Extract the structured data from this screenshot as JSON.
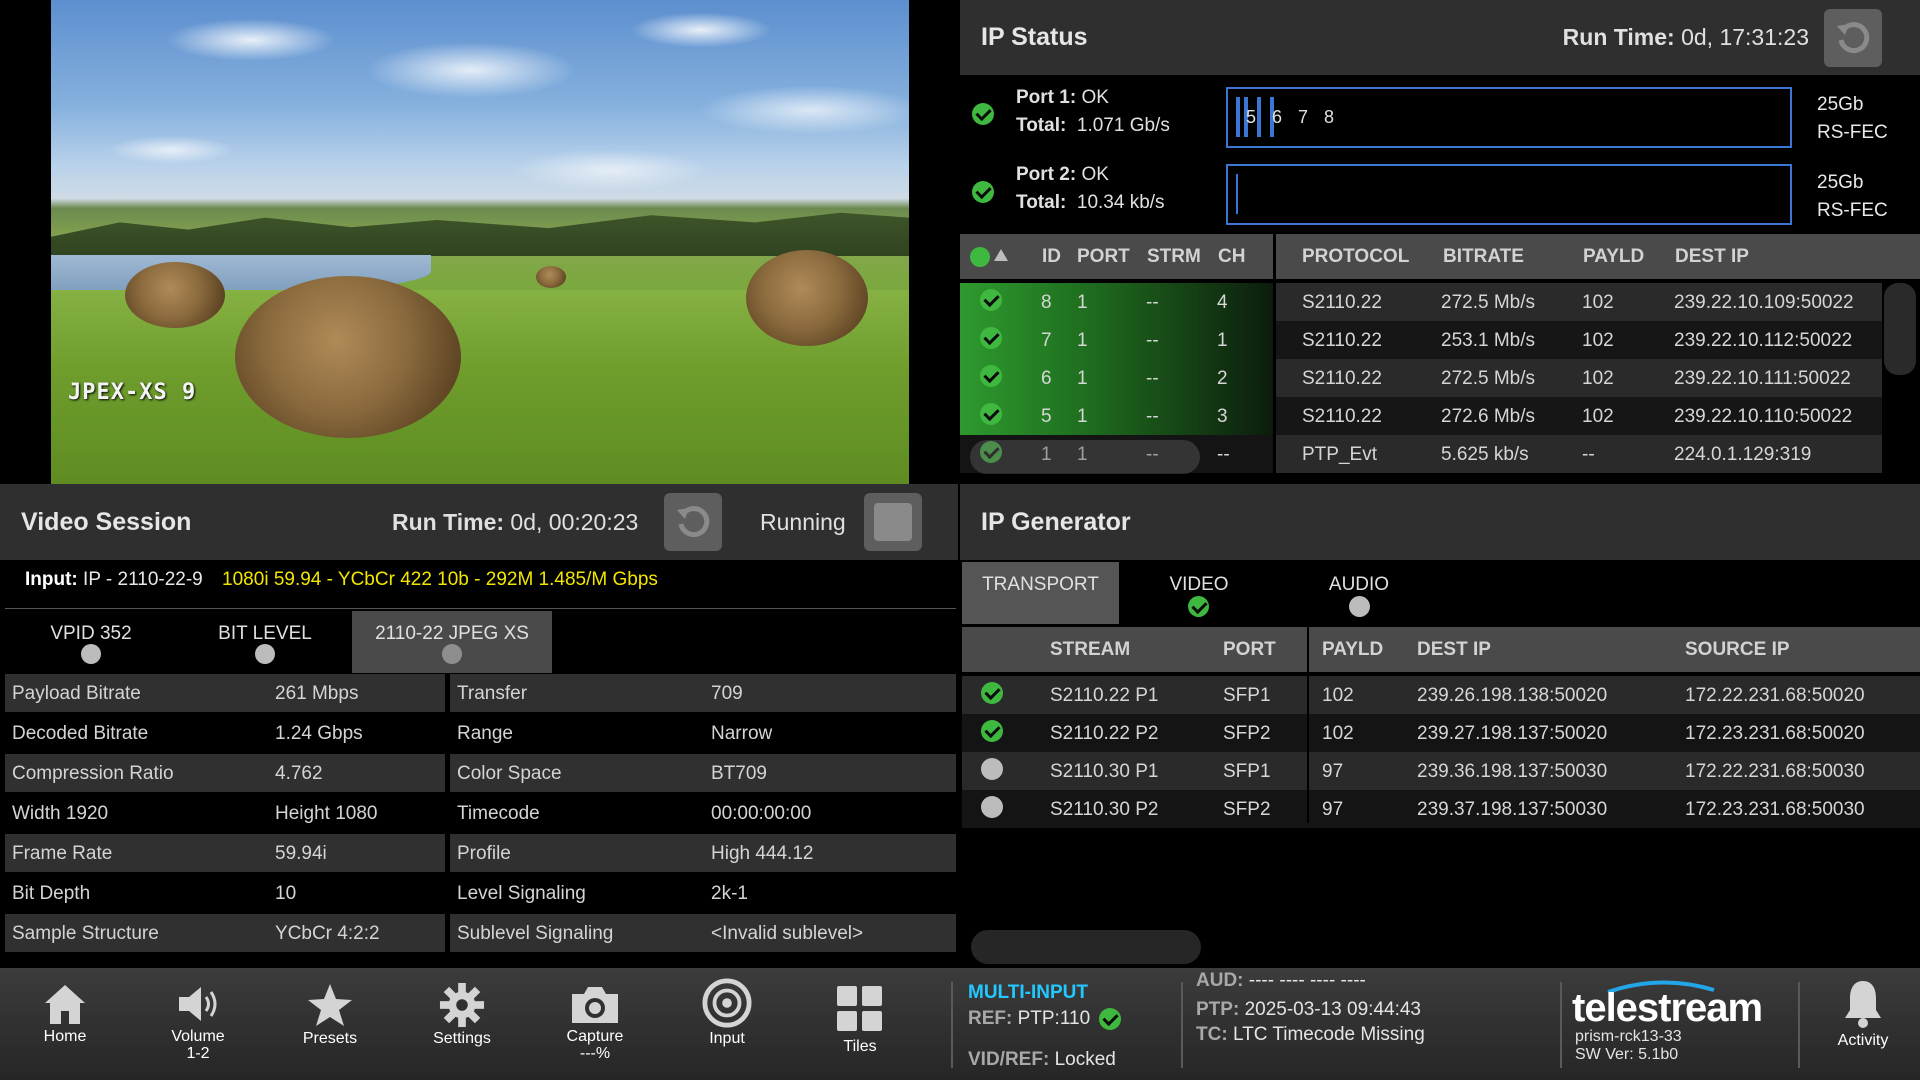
{
  "preview": {
    "overlay_label": "JPEX-XS 9"
  },
  "ip_status": {
    "title": "IP Status",
    "run_time_label": "Run Time:",
    "run_time_value": "0d, 17:31:23",
    "ports": [
      {
        "port_label": "Port 1:",
        "status": "OK",
        "total_label": "Total:",
        "total_value": "1.071 Gb/s",
        "bar_labels": [
          "5",
          "6",
          "7",
          "8"
        ],
        "speed": "25Gb",
        "fec": "RS-FEC"
      },
      {
        "port_label": "Port 2:",
        "status": "OK",
        "total_label": "Total:",
        "total_value": "10.34 kb/s",
        "bar_labels": [],
        "speed": "25Gb",
        "fec": "RS-FEC"
      }
    ],
    "columns": [
      "ID",
      "PORT",
      "STRM",
      "CH",
      "PROTOCOL",
      "BITRATE",
      "PAYLD",
      "DEST IP"
    ],
    "rows": [
      {
        "id": "8",
        "port": "1",
        "strm": "--",
        "ch": "4",
        "protocol": "S2110.22",
        "bitrate": "272.5 Mb/s",
        "payld": "102",
        "dest_ip": "239.22.10.109:50022"
      },
      {
        "id": "7",
        "port": "1",
        "strm": "--",
        "ch": "1",
        "protocol": "S2110.22",
        "bitrate": "253.1 Mb/s",
        "payld": "102",
        "dest_ip": "239.22.10.112:50022"
      },
      {
        "id": "6",
        "port": "1",
        "strm": "--",
        "ch": "2",
        "protocol": "S2110.22",
        "bitrate": "272.5 Mb/s",
        "payld": "102",
        "dest_ip": "239.22.10.111:50022"
      },
      {
        "id": "5",
        "port": "1",
        "strm": "--",
        "ch": "3",
        "protocol": "S2110.22",
        "bitrate": "272.6 Mb/s",
        "payld": "102",
        "dest_ip": "239.22.10.110:50022"
      },
      {
        "id": "1",
        "port": "1",
        "strm": "--",
        "ch": "--",
        "protocol": "PTP_Evt",
        "bitrate": "5.625 kb/s",
        "payld": "--",
        "dest_ip": "224.0.1.129:319"
      }
    ]
  },
  "video_session": {
    "title": "Video Session",
    "run_time_label": "Run Time:",
    "run_time_value": "0d, 00:20:23",
    "state": "Running",
    "input_label": "Input:",
    "input_value": "IP - 2110-22-9",
    "format": "1080i 59.94 - YCbCr 422 10b - 292M 1.485/M Gbps",
    "tabs": [
      "VPID 352",
      "BIT LEVEL",
      "2110-22 JPEG XS"
    ],
    "left_rows": [
      {
        "label": "Payload Bitrate",
        "value": "261 Mbps"
      },
      {
        "label": "Decoded Bitrate",
        "value": "1.24 Gbps"
      },
      {
        "label": "Compression Ratio",
        "value": "4.762"
      },
      {
        "label": "Width 1920",
        "value": "Height 1080"
      },
      {
        "label": "Frame Rate",
        "value": "59.94i"
      },
      {
        "label": "Bit Depth",
        "value": "10"
      },
      {
        "label": "Sample Structure",
        "value": "YCbCr 4:2:2"
      }
    ],
    "right_rows": [
      {
        "label": "Transfer",
        "value": "709"
      },
      {
        "label": "Range",
        "value": "Narrow"
      },
      {
        "label": "Color Space",
        "value": "BT709"
      },
      {
        "label": "Timecode",
        "value": "00:00:00:00"
      },
      {
        "label": "Profile",
        "value": "High 444.12"
      },
      {
        "label": "Level Signaling",
        "value": "2k-1"
      },
      {
        "label": "Sublevel Signaling",
        "value": "<Invalid sublevel>"
      }
    ]
  },
  "ip_generator": {
    "title": "IP Generator",
    "tabs": [
      "TRANSPORT",
      "VIDEO",
      "AUDIO"
    ],
    "columns": [
      "STREAM",
      "PORT",
      "PAYLD",
      "DEST IP",
      "SOURCE IP"
    ],
    "rows": [
      {
        "status": "ok",
        "stream": "S2110.22 P1",
        "port": "SFP1",
        "payld": "102",
        "dest_ip": "239.26.198.138:50020",
        "source_ip": "172.22.231.68:50020"
      },
      {
        "status": "ok",
        "stream": "S2110.22 P2",
        "port": "SFP2",
        "payld": "102",
        "dest_ip": "239.27.198.137:50020",
        "source_ip": "172.23.231.68:50020"
      },
      {
        "status": "off",
        "stream": "S2110.30 P1",
        "port": "SFP1",
        "payld": "97",
        "dest_ip": "239.36.198.137:50030",
        "source_ip": "172.22.231.68:50030"
      },
      {
        "status": "off",
        "stream": "S2110.30 P2",
        "port": "SFP2",
        "payld": "97",
        "dest_ip": "239.37.198.137:50030",
        "source_ip": "172.23.231.68:50030"
      }
    ]
  },
  "bottom_bar": {
    "nav": [
      {
        "label": "Home",
        "sub": ""
      },
      {
        "label": "Volume",
        "sub": "1-2"
      },
      {
        "label": "Presets",
        "sub": ""
      },
      {
        "label": "Settings",
        "sub": ""
      },
      {
        "label": "Capture",
        "sub": "---%"
      },
      {
        "label": "Input",
        "sub": ""
      },
      {
        "label": "Tiles",
        "sub": ""
      }
    ],
    "multi_input": "MULTI-INPUT",
    "ref_label": "REF:",
    "ref_value": "PTP:110",
    "vidref_label": "VID/REF:",
    "vidref_value": "Locked",
    "aud_label": "AUD:",
    "aud_value": "---- ---- ---- ----",
    "ptp_label": "PTP:",
    "ptp_value": "2025-03-13 09:44:43",
    "tc_label": "TC:",
    "tc_value": "LTC Timecode Missing",
    "brand": "telestream",
    "host": "prism-rck13-33",
    "sw_version": "SW Ver: 5.1b0",
    "activity": "Activity"
  },
  "colors": {
    "ok_green": "#3fb83f",
    "accent_blue": "#3b76d4",
    "format_yellow": "#f2e600",
    "multi_input_cyan": "#22c8ff"
  }
}
